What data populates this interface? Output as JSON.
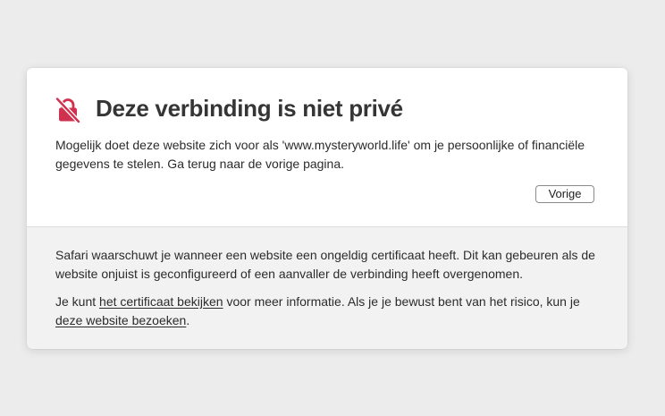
{
  "colors": {
    "page_background": "#ececec",
    "card_top": "#ffffff",
    "card_bottom": "#f2f2f2",
    "warning_icon": "#d0314f"
  },
  "warning": {
    "icon": "broken-lock-icon",
    "title": "Deze verbinding is niet privé",
    "description": "Mogelijk doet deze website zich voor als 'www.mysteryworld.life' om je persoonlijke of financiële gegevens te stelen. Ga terug naar de vorige pagina.",
    "back_button": "Vorige"
  },
  "details": {
    "paragraph1": "Safari waarschuwt je wanneer een website een ongeldig certificaat heeft. Dit kan gebeuren als de website onjuist is geconfigureerd of een aanvaller de verbinding heeft overgenomen.",
    "p2_before": "Je kunt ",
    "view_certificate_link": "het certificaat bekijken",
    "p2_middle": " voor meer informatie. Als je je bewust bent van het risico, kun je ",
    "visit_website_link": "deze website bezoeken",
    "p2_after": "."
  }
}
